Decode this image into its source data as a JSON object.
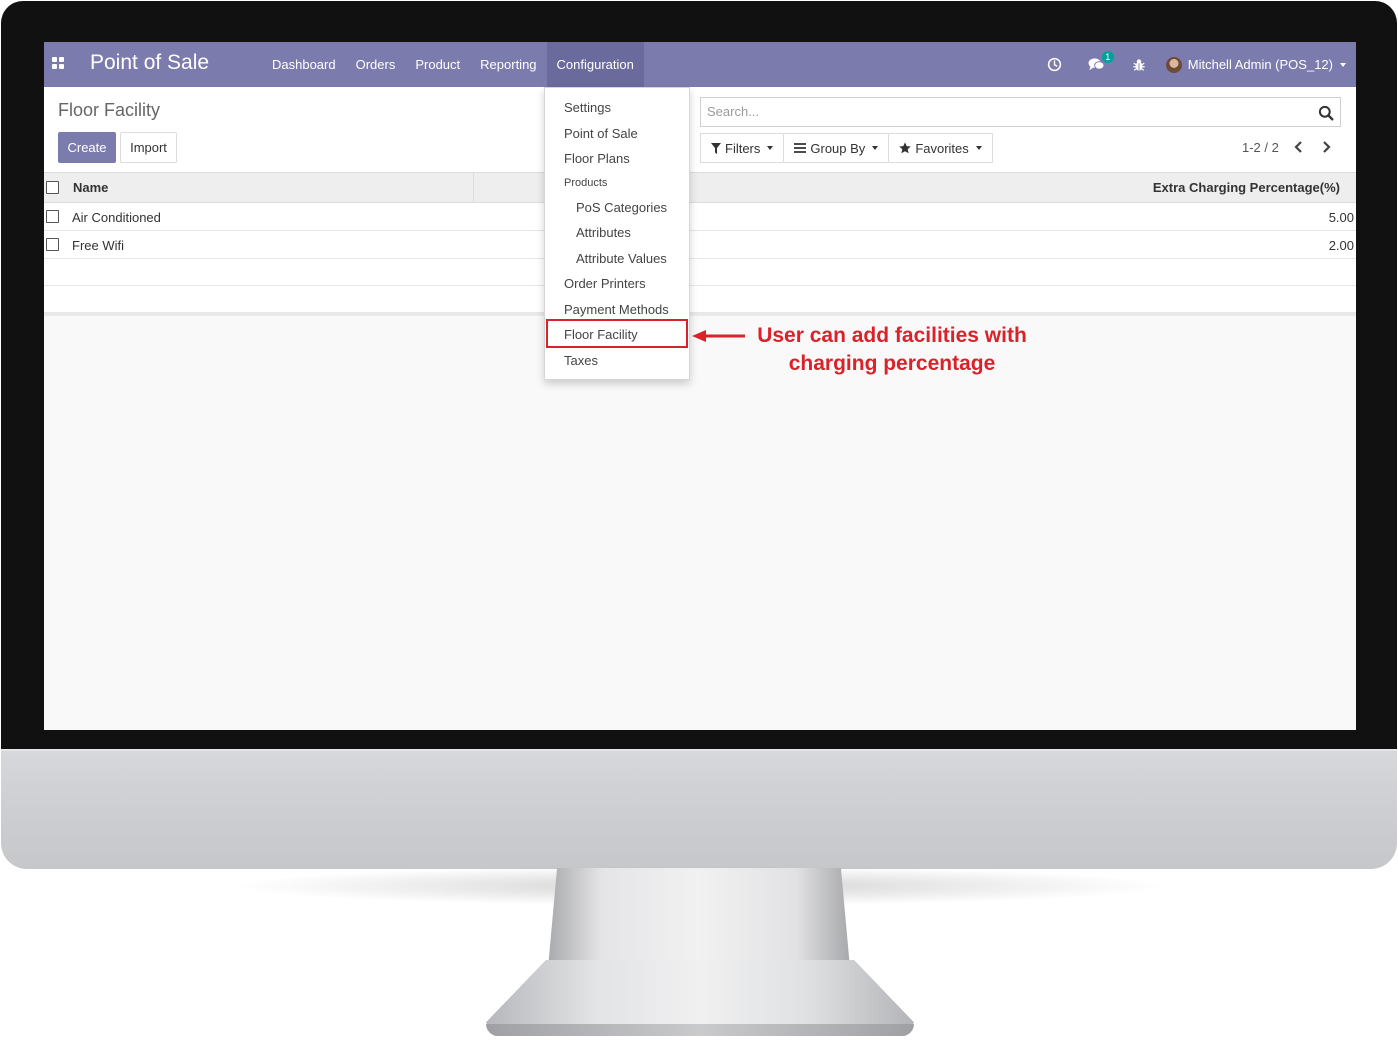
{
  "app": {
    "title": "Point of Sale",
    "menu": [
      "Dashboard",
      "Orders",
      "Product",
      "Reporting",
      "Configuration"
    ],
    "active_menu": "Configuration",
    "chat_badge": "1",
    "user": "Mitchell Admin (POS_12)",
    "accent_color": "#7c7bad"
  },
  "control_panel": {
    "page_title": "Floor Facility",
    "create_label": "Create",
    "import_label": "Import",
    "search_placeholder": "Search...",
    "filters_label": "Filters",
    "group_by_label": "Group By",
    "favorites_label": "Favorites",
    "pager": "1-2 / 2"
  },
  "table": {
    "columns": [
      "Name",
      "Extra Charging Percentage(%)"
    ],
    "rows": [
      {
        "name": "Air Conditioned",
        "value": "5.00"
      },
      {
        "name": "Free Wifi",
        "value": "2.00"
      }
    ]
  },
  "dropdown": {
    "items": [
      "Settings",
      "Point of Sale",
      "Floor Plans"
    ],
    "products_header": "Products",
    "product_items": [
      "PoS Categories",
      "Attributes",
      "Attribute Values"
    ],
    "more_items": [
      "Order Printers",
      "Payment Methods",
      "Floor Facility",
      "Taxes"
    ],
    "highlighted": "Floor Facility"
  },
  "annotation": {
    "line1": "User can add facilities with",
    "line2": "charging percentage",
    "color": "#d8232a"
  }
}
